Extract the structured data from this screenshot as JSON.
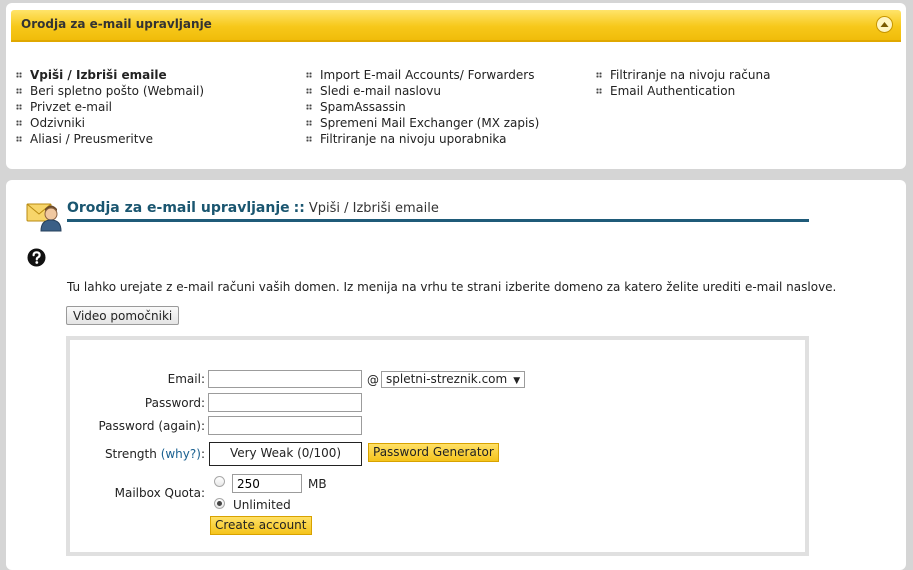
{
  "top": {
    "title": "Orodja za e-mail upravljanje",
    "columns": [
      [
        {
          "label": "Vpiši / Izbriši emaile",
          "active": true
        },
        {
          "label": "Beri spletno pošto (Webmail)"
        },
        {
          "label": "Privzet e-mail"
        },
        {
          "label": "Odzivniki"
        },
        {
          "label": "Aliasi / Preusmeritve"
        }
      ],
      [
        {
          "label": "Import E-mail Accounts/ Forwarders"
        },
        {
          "label": "Sledi e-mail naslovu"
        },
        {
          "label": "SpamAssassin"
        },
        {
          "label": "Spremeni Mail Exchanger (MX zapis)"
        },
        {
          "label": "Filtriranje na nivoju uporabnika"
        }
      ],
      [
        {
          "label": "Filtriranje na nivoju računa"
        },
        {
          "label": "Email Authentication"
        }
      ]
    ]
  },
  "main": {
    "title": "Orodja za e-mail upravljanje",
    "separator": "::",
    "subtitle": "Vpiši / Izbriši emaile",
    "description": "Tu lahko urejate z e-mail računi vaših domen. Iz menija na vrhu te strani izberite domeno za katero želite urediti e-mail naslove.",
    "video_button": "Video pomočniki"
  },
  "form": {
    "email_label": "Email:",
    "email_value": "",
    "at_sign": "@",
    "domain_selected": "spletni-streznik.com",
    "password_label": "Password:",
    "password_again_label": "Password (again):",
    "strength_label": "Strength",
    "strength_why": "(why?)",
    "strength_colon": ":",
    "strength_value": "Very Weak (0/100)",
    "password_generator_button": "Password Generator",
    "quota_label": "Mailbox Quota:",
    "quota_value": "250",
    "quota_unit": "MB",
    "unlimited_label": "Unlimited",
    "quota_selected": "unlimited",
    "create_button": "Create account"
  }
}
